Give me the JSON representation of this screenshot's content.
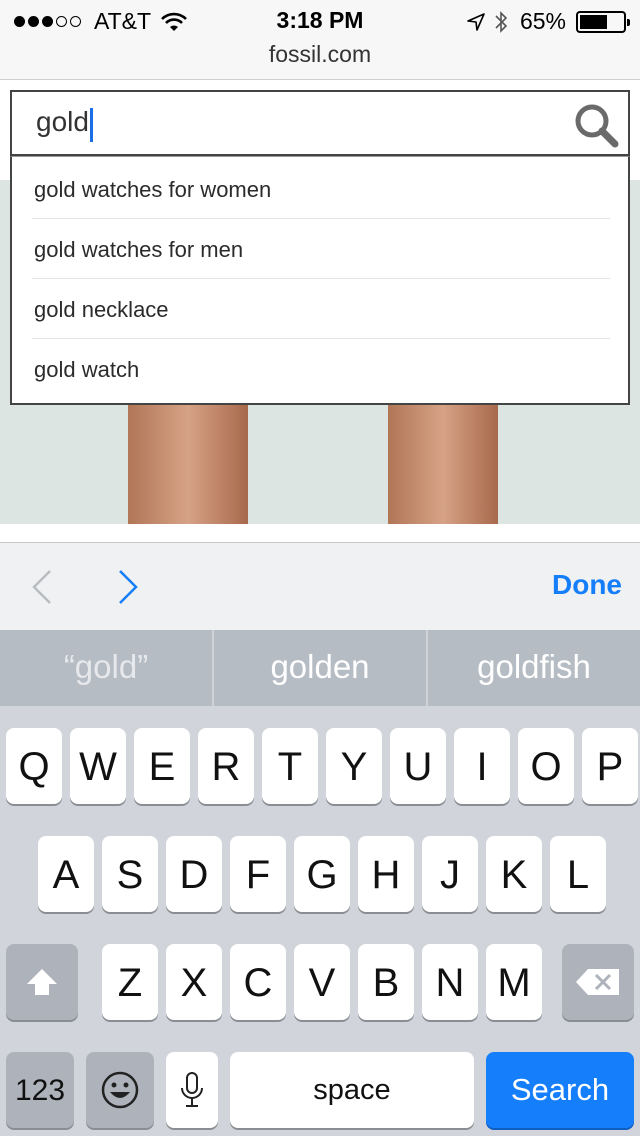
{
  "status_bar": {
    "carrier": "AT&T",
    "time": "3:18 PM",
    "battery": "65%"
  },
  "browser": {
    "domain": "fossil.com"
  },
  "search": {
    "value": "gold",
    "suggestions": [
      "gold watches for women",
      "gold watches for men",
      "gold necklace",
      "gold watch"
    ]
  },
  "form_assistant": {
    "done_label": "Done"
  },
  "keyboard": {
    "predictions": [
      "“gold”",
      "golden",
      "goldfish"
    ],
    "row1": [
      "Q",
      "W",
      "E",
      "R",
      "T",
      "Y",
      "U",
      "I",
      "O",
      "P"
    ],
    "row2": [
      "A",
      "S",
      "D",
      "F",
      "G",
      "H",
      "J",
      "K",
      "L"
    ],
    "row3": [
      "Z",
      "X",
      "C",
      "V",
      "B",
      "N",
      "M"
    ],
    "num_label": "123",
    "space_label": "space",
    "search_label": "Search"
  },
  "colors": {
    "accent": "#157efb",
    "keyboard_bg": "#d1d5db"
  }
}
